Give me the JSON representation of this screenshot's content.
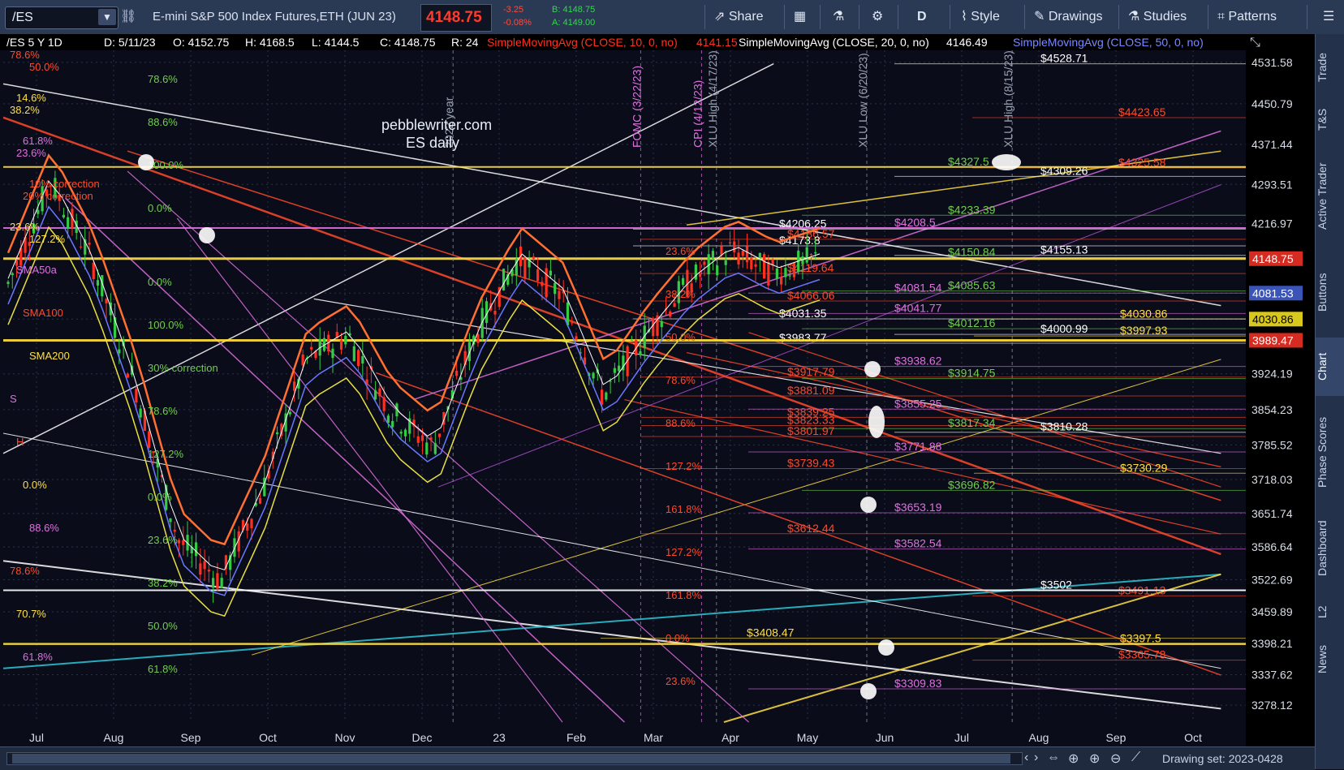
{
  "toolbar": {
    "symbol": "/ES",
    "instrument": "E-mini S&P 500 Index Futures,ETH (JUN 23)",
    "last": "4148.75",
    "net_change": "-3.25",
    "pct_change": "-0.08%",
    "bid": "B: 4148.75",
    "ask": "A: 4149.00",
    "share_label": "Share",
    "period_label": "D",
    "style_label": "Style",
    "drawings_label": "Drawings",
    "studies_label": "Studies",
    "patterns_label": "Patterns",
    "icons": [
      "dropdown-arrow-icon",
      "link-icon",
      "share-icon",
      "grid-icon",
      "flask-icon",
      "gear-icon",
      "style-icon",
      "pencil-icon",
      "studies-icon",
      "patterns-icon",
      "menu-icon"
    ]
  },
  "info_bar": {
    "chart_desc": "/ES 5 Y 1D",
    "date": "D: 5/11/23",
    "open": "O: 4152.75",
    "high": "H: 4168.5",
    "low": "L: 4144.5",
    "close": "C: 4148.75",
    "range": "R: 24",
    "sma10_label": "SimpleMovingAvg (CLOSE, 10, 0, no)",
    "sma10_value": "4141.15",
    "sma20_label": "SimpleMovingAvg (CLOSE, 20, 0, no)",
    "sma20_value": "4146.49",
    "sma50_label": "SimpleMovingAvg (CLOSE, 50, 0, no)"
  },
  "watermark": {
    "site": "pebblewriter.com",
    "subtitle": "ES daily"
  },
  "chart_data": {
    "type": "line",
    "title": "/ES 5 Y 1D",
    "ylim": [
      3245,
      4555
    ],
    "y_ticks": [
      "4531.58",
      "4450.79",
      "4371.44",
      "4293.51",
      "4216.97",
      "4148.75",
      "4081.53",
      "4030.86",
      "3989.47",
      "3924.19",
      "3854.23",
      "3785.52",
      "3718.03",
      "3651.74",
      "3586.64",
      "3522.69",
      "3459.89",
      "3398.21",
      "3337.62",
      "3278.12"
    ],
    "x_ticks": [
      "Jul",
      "Aug",
      "Sep",
      "Oct",
      "Nov",
      "Dec",
      "23",
      "Feb",
      "Mar",
      "Apr",
      "May",
      "Jun",
      "Jul",
      "Aug",
      "Sep",
      "Oct"
    ],
    "price_tags": [
      {
        "value": 4148.75,
        "label": "4148.75",
        "color": "#d62b20"
      },
      {
        "value": 4081.53,
        "label": "4081.53",
        "color": "#3b54b8"
      },
      {
        "value": 4030.86,
        "label": "4030.86",
        "color": "#d8c81c"
      },
      {
        "value": 3989.47,
        "label": "3989.47",
        "color": "#d62b20"
      }
    ],
    "vertical_labels": [
      {
        "x": 0.513,
        "text": "FOMC (3/22/23)",
        "color": "#e070e0"
      },
      {
        "x": 0.562,
        "text": "CPI (4/12/23)",
        "color": "#e070e0"
      },
      {
        "x": 0.574,
        "text": "XLU High (4/17/23)",
        "color": "#9aa0b0"
      },
      {
        "x": 0.695,
        "text": "XLU Low (6/20/23)",
        "color": "#9aa0b0"
      },
      {
        "x": 0.812,
        "text": "XLU High (8/15/23)",
        "color": "#9aa0b0"
      },
      {
        "x": 0.362,
        "text": "2022 year",
        "color": "#9aa0b0"
      }
    ],
    "levels": [
      {
        "v": 4528.71,
        "label": "$4528.71",
        "color": "#ffffff"
      },
      {
        "v": 4423.65,
        "label": "$4423.65",
        "color": "#ff4a2a"
      },
      {
        "v": 4327.5,
        "label": "$4327.5",
        "color": "#6fd04a"
      },
      {
        "v": 4325.58,
        "label": "$4325.58",
        "color": "#ff4a2a"
      },
      {
        "v": 4309.26,
        "label": "$4309.26",
        "color": "#ffffff"
      },
      {
        "v": 4233.39,
        "label": "$4233.39",
        "color": "#6fd04a"
      },
      {
        "v": 4208.5,
        "label": "$4208.5",
        "color": "#e070e0"
      },
      {
        "v": 4206.25,
        "label": "$4206.25",
        "color": "#ffffff"
      },
      {
        "v": 4186.57,
        "label": "$4186.57",
        "color": "#ff4a2a"
      },
      {
        "v": 4173.8,
        "label": "$4173.8",
        "color": "#ffffff"
      },
      {
        "v": 4155.13,
        "label": "$4155.13",
        "color": "#ffffff"
      },
      {
        "v": 4150.84,
        "label": "$4150.84",
        "color": "#6fd04a"
      },
      {
        "v": 4119.64,
        "label": "$4119.64",
        "color": "#ff4a2a"
      },
      {
        "v": 4085.63,
        "label": "$4085.63",
        "color": "#6fd04a"
      },
      {
        "v": 4081.54,
        "label": "$4081.54",
        "color": "#e070e0"
      },
      {
        "v": 4066.06,
        "label": "$4066.06",
        "color": "#ff4a2a"
      },
      {
        "v": 4041.77,
        "label": "$4041.77",
        "color": "#e070e0"
      },
      {
        "v": 4031.35,
        "label": "$4031.35",
        "color": "#ffffff"
      },
      {
        "v": 4030.86,
        "label": "$4030.86",
        "color": "#ffe040"
      },
      {
        "v": 4012.16,
        "label": "$4012.16",
        "color": "#6fd04a"
      },
      {
        "v": 4000.99,
        "label": "$4000.99",
        "color": "#ffffff"
      },
      {
        "v": 3997.93,
        "label": "$3997.93",
        "color": "#ffe040"
      },
      {
        "v": 3983.77,
        "label": "$3983.77",
        "color": "#ffffff"
      },
      {
        "v": 3938.62,
        "label": "$3938.62",
        "color": "#e070e0"
      },
      {
        "v": 3917.79,
        "label": "$3917.79",
        "color": "#ff4a2a"
      },
      {
        "v": 3914.75,
        "label": "$3914.75",
        "color": "#6fd04a"
      },
      {
        "v": 3881.09,
        "label": "$3881.09",
        "color": "#ff4a2a"
      },
      {
        "v": 3855.25,
        "label": "$3855.25",
        "color": "#e070e0"
      },
      {
        "v": 3839.25,
        "label": "$3839.25",
        "color": "#ff4a2a"
      },
      {
        "v": 3823.33,
        "label": "$3823.33",
        "color": "#ff4a2a"
      },
      {
        "v": 3817.34,
        "label": "$3817.34",
        "color": "#6fd04a"
      },
      {
        "v": 3810.28,
        "label": "$3810.28",
        "color": "#ffffff"
      },
      {
        "v": 3801.97,
        "label": "$3801.97",
        "color": "#ff4a2a"
      },
      {
        "v": 3771.88,
        "label": "$3771.88",
        "color": "#e070e0"
      },
      {
        "v": 3739.43,
        "label": "$3739.43",
        "color": "#ff4a2a"
      },
      {
        "v": 3730.29,
        "label": "$3730.29",
        "color": "#ffe040"
      },
      {
        "v": 3696.82,
        "label": "$3696.82",
        "color": "#6fd04a"
      },
      {
        "v": 3653.19,
        "label": "$3653.19",
        "color": "#e070e0"
      },
      {
        "v": 3612.44,
        "label": "$3612.44",
        "color": "#ff4a2a"
      },
      {
        "v": 3582.54,
        "label": "$3582.54",
        "color": "#e070e0"
      },
      {
        "v": 3502,
        "label": "$3502",
        "color": "#ffffff"
      },
      {
        "v": 3491.13,
        "label": "$3491.13",
        "color": "#ff4a2a"
      },
      {
        "v": 3408.47,
        "label": "$3408.47",
        "color": "#ffe040"
      },
      {
        "v": 3397.5,
        "label": "$3397.5",
        "color": "#ffe040"
      },
      {
        "v": 3365.78,
        "label": "$3365.78",
        "color": "#ff4a2a"
      },
      {
        "v": 3309.83,
        "label": "$3309.83",
        "color": "#e070e0"
      }
    ],
    "fib_labels": [
      "78.6%",
      "14.6%",
      "61.8%",
      "10% correction",
      "23.6%",
      "SMA50a",
      "SMA100",
      "SMA200",
      "S",
      "H",
      "0.0%",
      "88.6%",
      "78.6%",
      "70.7%",
      "61.8%",
      "50.0%",
      "38.2%",
      "23.6%",
      "20% correction",
      "127.2%",
      "0.0%",
      "100.0%",
      "30% correction",
      "78.6%",
      "127.2%",
      "0.0%",
      "23.6%",
      "38.2%",
      "50.0%",
      "61.8%",
      "78.6%",
      "88.6%",
      "100.0%",
      "0.0%",
      "23.6%",
      "38.2%",
      "50.0%",
      "78.6%",
      "88.6%",
      "127.2%",
      "161.8%",
      "127.2%",
      "161.8%",
      "0.0%",
      "23.6%"
    ],
    "grid": true
  },
  "sidebar": {
    "tabs": [
      "Trade",
      "T&S",
      "Active Trader",
      "Buttons",
      "Chart",
      "Phase Scores",
      "Dashboard",
      "L2",
      "News"
    ],
    "active": "Chart"
  },
  "bottombar": {
    "drawing_set": "Drawing set: 2023-0428",
    "icons": [
      "scroll-left-icon",
      "scroll-right-icon",
      "scroll-both-icon",
      "crosshair-icon",
      "zoom-in-icon",
      "zoom-out-icon",
      "draw-icon"
    ]
  },
  "colors": {
    "chart_bg": "#0a0c1a",
    "grid": "#2a3246",
    "sma10": "#ff3020",
    "sma20": "#ffffff",
    "sma50": "#6a78ff",
    "sma100": "#e8e040",
    "sma200": "#ff7030",
    "fib_pink": "#e070e0",
    "fib_green": "#6fd04a",
    "fib_red": "#ff4a2a",
    "fib_yellow": "#ffe040",
    "up_candle": "#33cc44",
    "down_candle": "#ff3020"
  }
}
